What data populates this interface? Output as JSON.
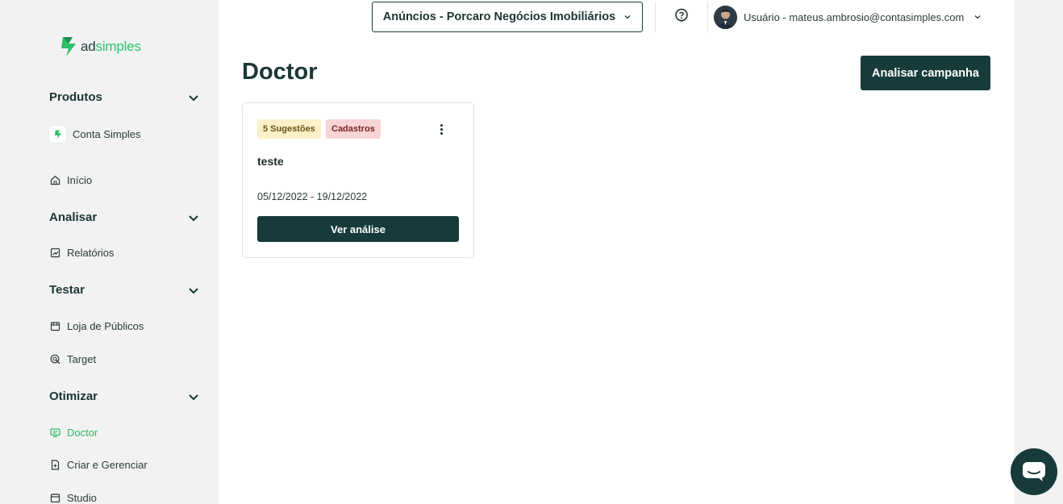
{
  "sidebar": {
    "logo": {
      "ad": "ad",
      "simples": "simples"
    },
    "sections": [
      {
        "label": "Produtos"
      },
      {
        "label": "Analisar"
      },
      {
        "label": "Testar"
      },
      {
        "label": "Otimizar"
      }
    ],
    "items": {
      "conta_simples": "Conta Simples",
      "inicio": "Início",
      "relatorios": "Relatórios",
      "loja_publicos": "Loja de Públicos",
      "target": "Target",
      "doctor": "Doctor",
      "criar_gerenciar": "Criar e Gerenciar",
      "studio": "Studio"
    }
  },
  "header": {
    "account_select": "Anúncios - Porcaro Negócios Imobiliários",
    "user_label": "Usuário - mateus.ambrosio@contasimples.com"
  },
  "main": {
    "title": "Doctor",
    "analyze_button": "Analisar campanha",
    "card": {
      "badge_suggestions": "5 Sugestões",
      "badge_category": "Cadastros",
      "title": "teste",
      "dates": "05/12/2022 - 19/12/2022",
      "button": "Ver análise"
    }
  },
  "colors": {
    "primary_dark": "#173b3b",
    "brand_green": "#2dc06a",
    "active_green": "#2db866"
  }
}
